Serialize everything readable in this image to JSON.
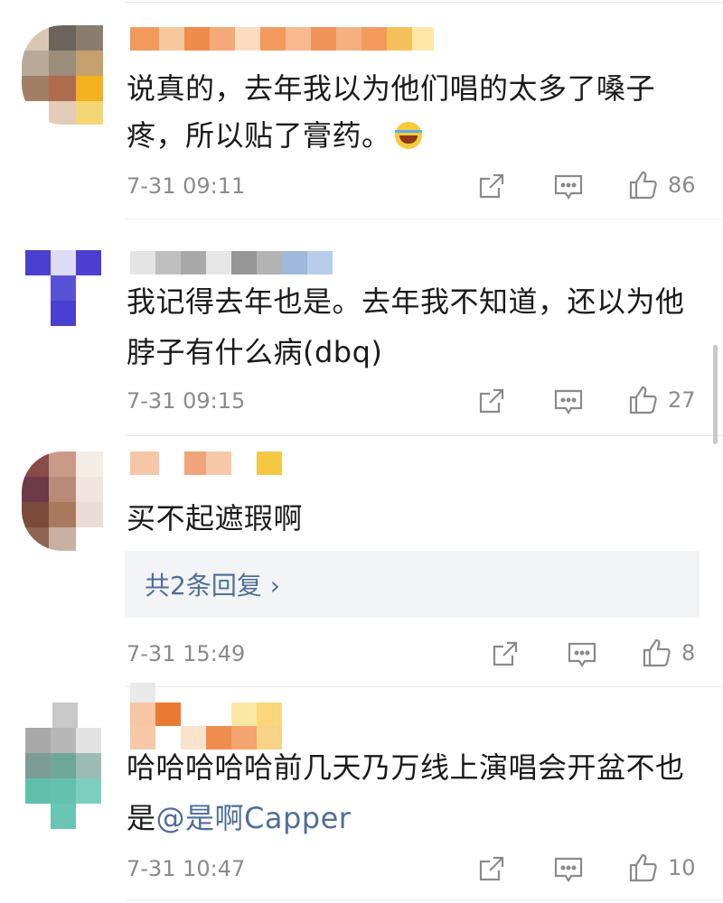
{
  "comments": [
    {
      "lines": [
        "说真的，去年我以为他们唱的太多了嗓子",
        "疼，所以贴了膏药。"
      ],
      "emoji": "laughing-tears-emoji",
      "time": "7-31 09:11",
      "likes": "86"
    },
    {
      "lines": [
        "我记得去年也是。去年我不知道，还以为他",
        "脖子有什么病(dbq)"
      ],
      "time": "7-31 09:15",
      "likes": "27"
    },
    {
      "lines": [
        "买不起遮瑕啊"
      ],
      "replies_label": "共2条回复 ›",
      "time": "7-31 15:49",
      "likes": "8"
    },
    {
      "line1": "哈哈哈哈哈前几天乃万线上演唱会开盆不也",
      "line2_prefix": "是",
      "mention": "@是啊Capper",
      "time": "7-31 10:47",
      "likes": "10"
    }
  ],
  "colors": {
    "text": "#1a1a1a",
    "meta": "#8a8a8a",
    "link": "#4e6e9b",
    "reply_bg": "#f3f4f6"
  },
  "icons": [
    "share-icon",
    "comment-icon",
    "thumbs-up-icon"
  ]
}
